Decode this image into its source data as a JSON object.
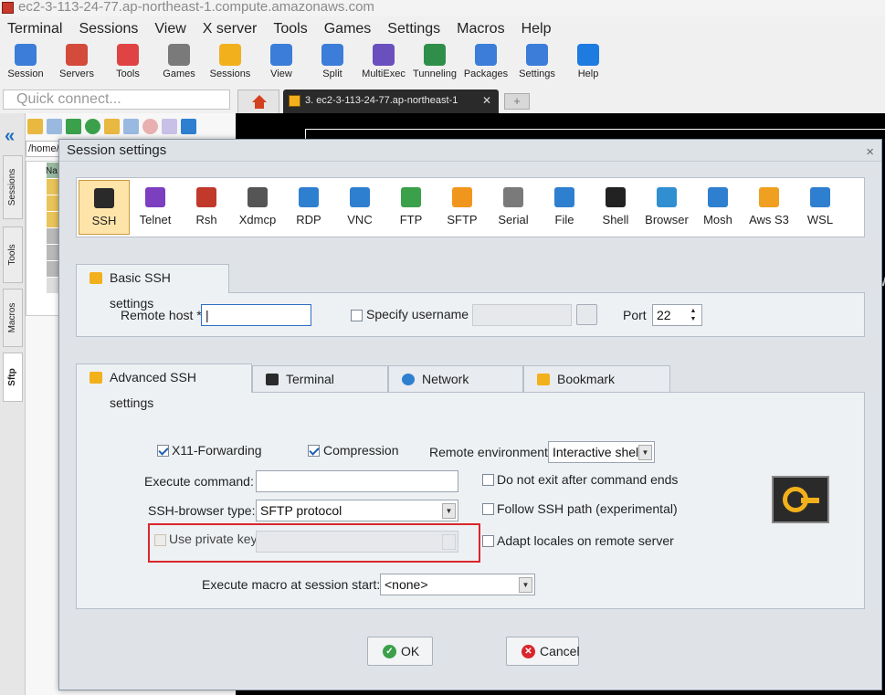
{
  "window": {
    "title": "ec2-3-113-24-77.ap-northeast-1.compute.amazonaws.com"
  },
  "menu": [
    "Terminal",
    "Sessions",
    "View",
    "X server",
    "Tools",
    "Games",
    "Settings",
    "Macros",
    "Help"
  ],
  "toolbar": [
    {
      "label": "Session",
      "icon": "session-icon",
      "color": "#3b7dd8"
    },
    {
      "label": "Servers",
      "icon": "servers-icon",
      "color": "#d44a3b"
    },
    {
      "label": "Tools",
      "icon": "tools-icon",
      "color": "#e04343"
    },
    {
      "label": "Games",
      "icon": "games-icon",
      "color": "#7a7a7a"
    },
    {
      "label": "Sessions",
      "icon": "star-icon",
      "color": "#f2b01c"
    },
    {
      "label": "View",
      "icon": "view-icon",
      "color": "#3b7dd8"
    },
    {
      "label": "Split",
      "icon": "split-icon",
      "color": "#3b7dd8"
    },
    {
      "label": "MultiExec",
      "icon": "multiexec-icon",
      "color": "#6a4fbf"
    },
    {
      "label": "Tunneling",
      "icon": "tunneling-icon",
      "color": "#2f8f4a"
    },
    {
      "label": "Packages",
      "icon": "packages-icon",
      "color": "#3b7dd8"
    },
    {
      "label": "Settings",
      "icon": "gear-icon",
      "color": "#3b7dd8"
    },
    {
      "label": "Help",
      "icon": "help-icon",
      "color": "#1e7be0"
    }
  ],
  "quick_connect": {
    "placeholder": "Quick connect..."
  },
  "tabs": {
    "session_tab": "3. ec2-3-113-24-77.ap-northeast-1",
    "close": "✕",
    "add": "+"
  },
  "left_tabs": [
    "Sessions",
    "Tools",
    "Macros",
    "Sftp"
  ],
  "sftp": {
    "path": "/home/u",
    "name_header": "Na"
  },
  "dialog": {
    "title": "Session settings",
    "close": "×",
    "protocols": [
      {
        "label": "SSH",
        "color": "#2a2a2a"
      },
      {
        "label": "Telnet",
        "color": "#7b3fbf"
      },
      {
        "label": "Rsh",
        "color": "#c0392b"
      },
      {
        "label": "Xdmcp",
        "color": "#555"
      },
      {
        "label": "RDP",
        "color": "#2f7fd0"
      },
      {
        "label": "VNC",
        "color": "#2f7fd0"
      },
      {
        "label": "FTP",
        "color": "#3aa04a"
      },
      {
        "label": "SFTP",
        "color": "#f0961c"
      },
      {
        "label": "Serial",
        "color": "#7a7a7a"
      },
      {
        "label": "File",
        "color": "#2f7fd0"
      },
      {
        "label": "Shell",
        "color": "#222"
      },
      {
        "label": "Browser",
        "color": "#2f8fd0"
      },
      {
        "label": "Mosh",
        "color": "#2f7fd0"
      },
      {
        "label": "Aws S3",
        "color": "#f0a020"
      },
      {
        "label": "WSL",
        "color": "#2f7fd0"
      }
    ],
    "basic": {
      "tab": "Basic SSH settings",
      "remote_host_label": "Remote host *",
      "remote_host_value": "",
      "specify_username_label": "Specify username",
      "username_value": "",
      "port_label": "Port",
      "port_value": "22"
    },
    "adv_tabs": [
      "Advanced SSH settings",
      "Terminal settings",
      "Network settings",
      "Bookmark settings"
    ],
    "advanced": {
      "x11_label": "X11-Forwarding",
      "x11_checked": true,
      "compression_label": "Compression",
      "compression_checked": true,
      "remote_env_label": "Remote environment:",
      "remote_env_value": "Interactive shell",
      "exec_cmd_label": "Execute command:",
      "exec_cmd_value": "",
      "no_exit_label": "Do not exit after command ends",
      "browser_type_label": "SSH-browser type:",
      "browser_type_value": "SFTP protocol",
      "follow_path_label": "Follow SSH path (experimental)",
      "private_key_label": "Use private key",
      "adapt_locales_label": "Adapt locales on remote server",
      "macro_label": "Execute macro at session start:",
      "macro_value": "<none>"
    },
    "ok": "OK",
    "cancel": "Cancel"
  },
  "colors": {
    "accent": "#f2b01c",
    "highlight_border": "#d9262c",
    "ok": "#3aa04a",
    "cancel": "#d9262c"
  }
}
